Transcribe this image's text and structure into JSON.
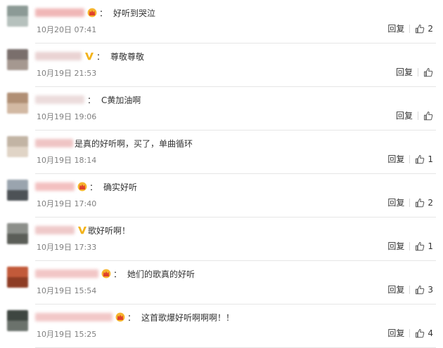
{
  "reply_label": "回复",
  "comments": [
    {
      "text": "好听到哭泣",
      "time": "10月20日 07:41",
      "likes": "2",
      "badge": "crown",
      "has_colon": true,
      "name_width": 70,
      "name_color": "#f0b6b6",
      "avatar": [
        "#8c9a96",
        "#b6c1bd"
      ]
    },
    {
      "text": "尊敬尊敬",
      "time": "10月19日 21:53",
      "likes": "",
      "badge": "v",
      "has_colon": true,
      "name_width": 66,
      "name_color": "#ead3d3",
      "avatar": [
        "#7a6f6c",
        "#a59890"
      ]
    },
    {
      "text": "C黄加油啊",
      "time": "10月19日 19:06",
      "likes": "",
      "badge": "",
      "has_colon": true,
      "name_width": 70,
      "name_color": "#ecdcdc",
      "avatar": [
        "#b08f74",
        "#d2b9a3"
      ]
    },
    {
      "text": "是真的好听啊，买了，单曲循环",
      "time": "10月19日 18:14",
      "likes": "1",
      "badge": "",
      "has_colon": false,
      "name_width": 54,
      "name_color": "#efc4c4",
      "avatar": [
        "#c2b4a4",
        "#e0d4c6"
      ]
    },
    {
      "text": "确实好听",
      "time": "10月19日 17:40",
      "likes": "2",
      "badge": "crown",
      "has_colon": true,
      "name_width": 56,
      "name_color": "#f3c0c0",
      "avatar": [
        "#9aa4ae",
        "#4d5256"
      ]
    },
    {
      "text": "歌好听啊！",
      "time": "10月19日 17:33",
      "likes": "1",
      "badge": "v",
      "has_colon": false,
      "name_width": 56,
      "name_color": "#efc9c9",
      "avatar": [
        "#8c8f8a",
        "#5b5e58"
      ]
    },
    {
      "text": "她们的歌真的好听",
      "time": "10月19日 15:54",
      "likes": "3",
      "badge": "crown",
      "has_colon": true,
      "name_width": 90,
      "name_color": "#f2c6c6",
      "avatar": [
        "#c25a3a",
        "#8e3c24"
      ]
    },
    {
      "text": "这首歌爆好听啊啊啊！！",
      "time": "10月19日 15:25",
      "likes": "4",
      "badge": "crown",
      "has_colon": true,
      "name_width": 110,
      "name_color": "#f2c8c8",
      "avatar": [
        "#3e4641",
        "#6b726c"
      ]
    }
  ]
}
